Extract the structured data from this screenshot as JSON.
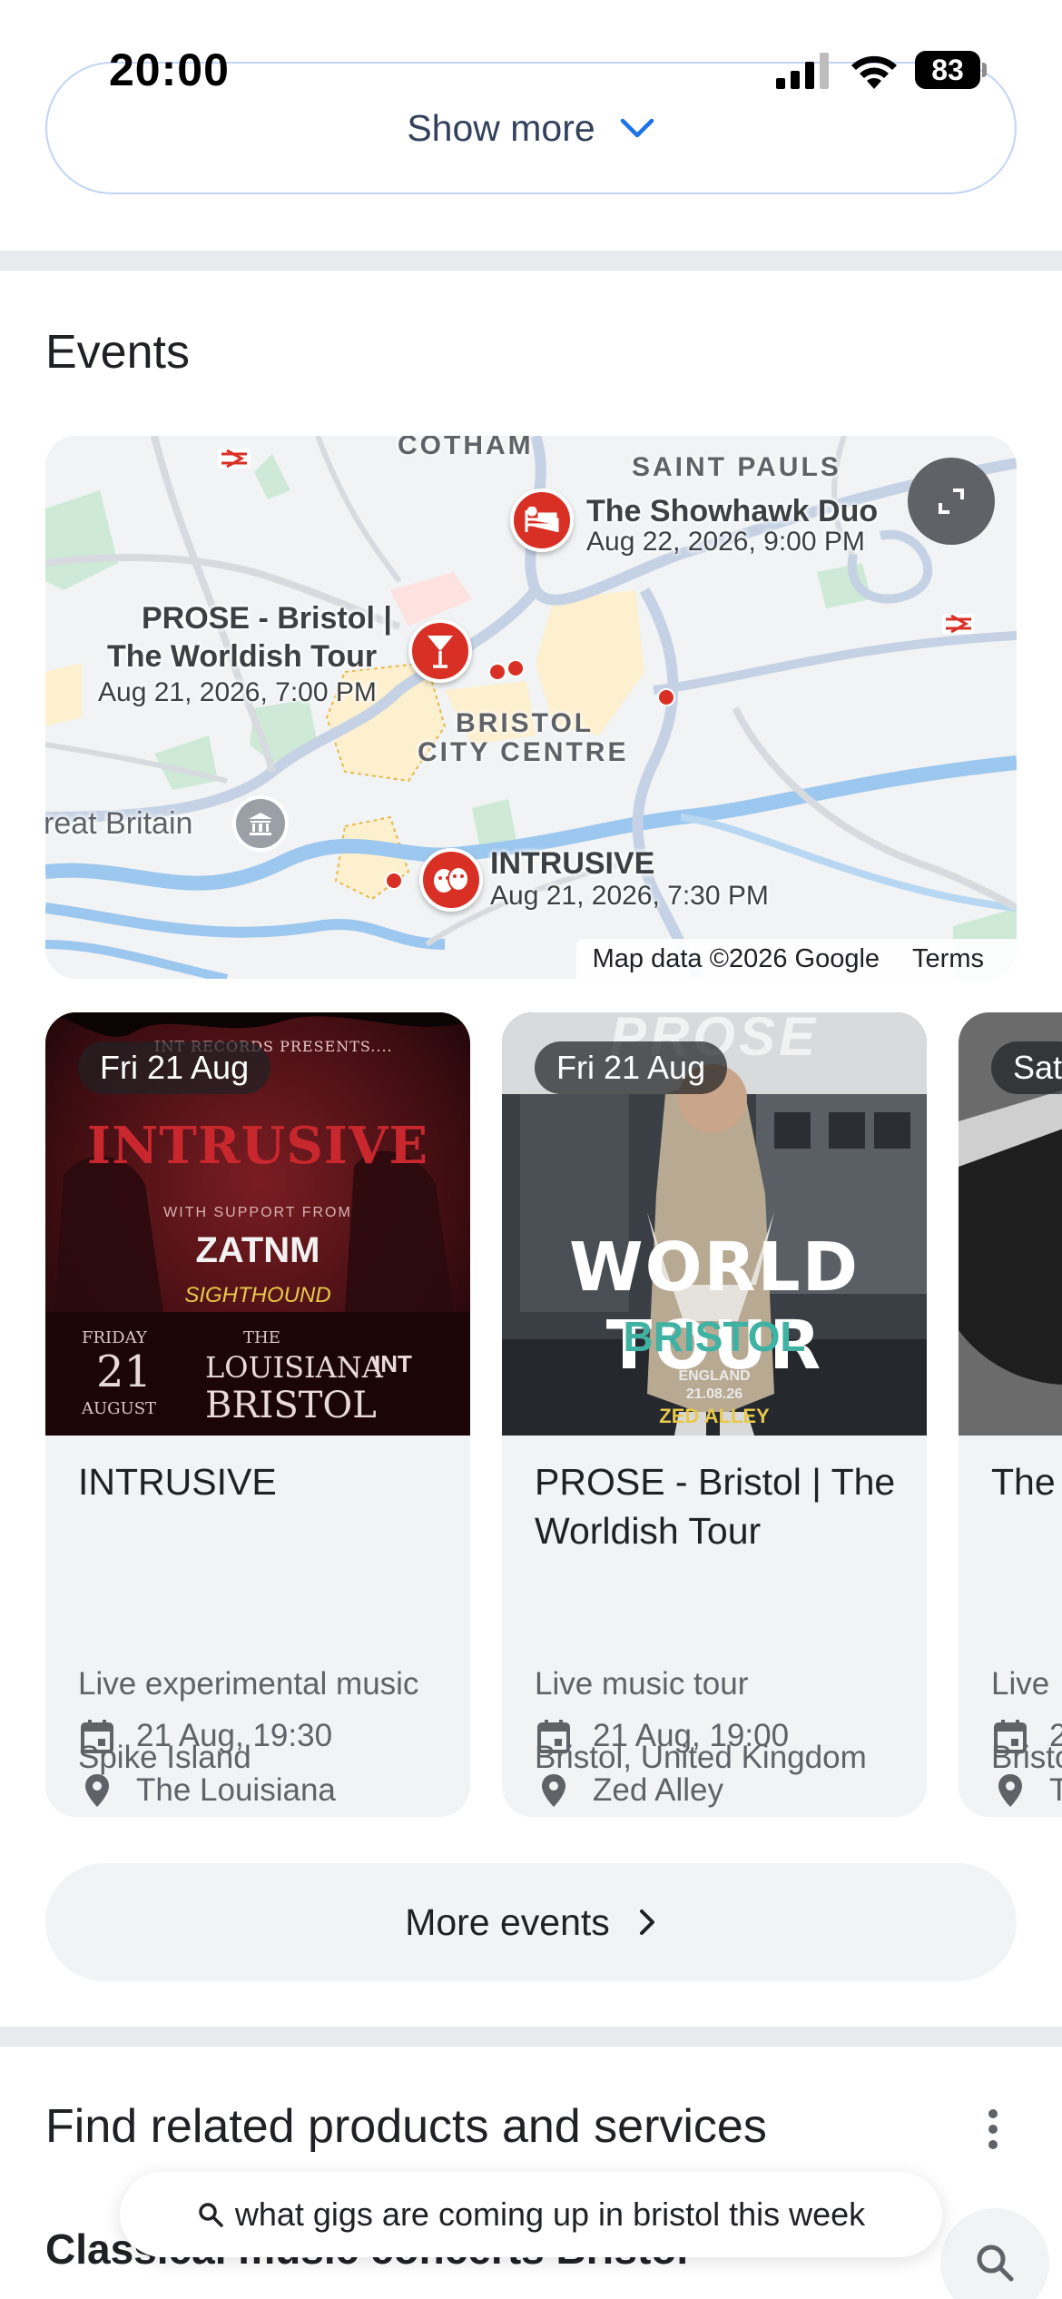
{
  "status_bar": {
    "time": "20:00",
    "battery": "83"
  },
  "show_more": {
    "label": "Show more"
  },
  "events": {
    "title": "Events",
    "map": {
      "areas": [
        "COTHAM",
        "SAINT PAULS",
        "BRISTOL",
        "CITY CENTRE"
      ],
      "place_label": "reat Britain",
      "pins": [
        {
          "title": "The Showhawk Duo",
          "date": "Aug 22, 2026, 9:00 PM",
          "icon": "hotel-icon"
        },
        {
          "title_line1": "PROSE - Bristol |",
          "title_line2": "The Worldish Tour",
          "date": "Aug 21, 2026, 7:00 PM",
          "icon": "cocktail-icon"
        },
        {
          "title": "INTRUSIVE",
          "date": "Aug 21, 2026, 7:30 PM",
          "icon": "theater-masks-icon"
        }
      ],
      "attribution": "Map data ©2026 Google",
      "terms": "Terms"
    },
    "cards": [
      {
        "date_chip": "Fri 21 Aug",
        "title": "INTRUSIVE",
        "type": "Live experimental music",
        "datetime": "21 Aug, 19:30",
        "venue": "The Louisiana",
        "location": "Spike Island",
        "poster": {
          "presents": "INT RECORDS PRESENTS....",
          "headline": "INTRUSIVE",
          "support": "WITH SUPPORT FROM",
          "act1": "ZATNM",
          "act2": "SIGHTHOUND",
          "day": "FRIDAY",
          "date_num": "21",
          "month": "AUGUST",
          "venue_small": "THE",
          "venue1": "LOUISIANA",
          "venue2": "BRISTOL",
          "badge": "INT"
        }
      },
      {
        "date_chip": "Fri 21 Aug",
        "title": "PROSE - Bristol | The Worldish Tour",
        "type": "Live music tour",
        "datetime": "21 Aug, 19:00",
        "venue": "Zed Alley",
        "location": "Bristol, United Kingdom",
        "poster": {
          "top": "PROSE",
          "headline": "WORLD TOUR",
          "city": "BRISTOL",
          "country": "ENGLAND",
          "date": "21.08.26",
          "venue": "ZED ALLEY"
        }
      },
      {
        "date_chip": "Sat",
        "title": "The",
        "type": "Live",
        "datetime": "2",
        "venue": "T",
        "location": "Bristo"
      }
    ],
    "more_events": "More events"
  },
  "related": {
    "title": "Find related products and services",
    "first_item": "Classical music concerts Bristol"
  },
  "search_query": "what gigs are coming up in bristol this week",
  "colors": {
    "accent_blue": "#1a73e8",
    "pin_red": "#d93025",
    "chip_bg": "#f1f3f4",
    "divider": "#e8eaed"
  }
}
